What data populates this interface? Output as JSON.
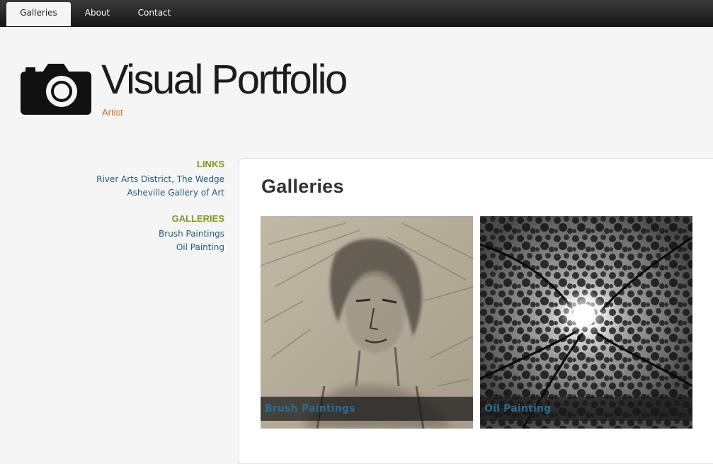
{
  "nav": {
    "tabs": [
      {
        "label": "Galleries",
        "active": true
      },
      {
        "label": "About",
        "active": false
      },
      {
        "label": "Contact",
        "active": false
      }
    ]
  },
  "header": {
    "logo_icon": "camera-icon",
    "title": "Visual Portfolio",
    "subtitle": "Artist"
  },
  "sidebar": {
    "links": {
      "heading": "LINKS",
      "items": [
        "River Arts District, The Wedge",
        "Asheville Gallery of Art"
      ]
    },
    "galleries": {
      "heading": "GALLERIES",
      "items": [
        "Brush Paintings",
        "Oil Painting"
      ]
    }
  },
  "main": {
    "title": "Galleries",
    "cards": [
      {
        "label": "Brush Paintings",
        "image": "charcoal portrait sketch"
      },
      {
        "label": "Oil Painting",
        "image": "black-and-white tree canopy with sun"
      }
    ]
  },
  "colors": {
    "nav_bar": "#1e1e1e",
    "accent_heading": "#7f9a1e",
    "link": "#1f5b84",
    "subtitle": "#c76a18",
    "caption_text": "#2c6c8c"
  }
}
